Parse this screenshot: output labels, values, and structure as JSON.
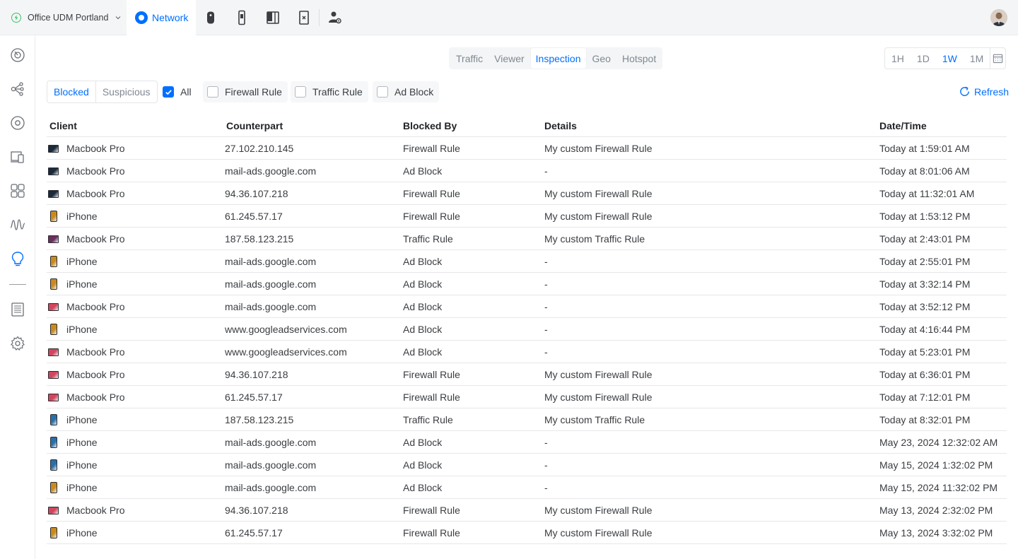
{
  "site": {
    "name": "Office UDM Portland"
  },
  "app": {
    "name": "Network",
    "accent": "#006fff"
  },
  "topbar_icons": [
    "access-point-icon",
    "phone-device-icon",
    "door-access-icon",
    "talk-device-icon",
    "admin-user-icon"
  ],
  "sidebar_icons": [
    "dashboard-icon",
    "topology-icon",
    "devices-icon",
    "client-devices-icon",
    "ports-icon",
    "insights-icon",
    "inspection-icon",
    "logs-icon",
    "settings-icon"
  ],
  "tabs": {
    "traffic": "Traffic",
    "viewer": "Viewer",
    "inspection": "Inspection",
    "geo": "Geo",
    "hotspot": "Hotspot",
    "active": "Inspection"
  },
  "range": {
    "h1": "1H",
    "d1": "1D",
    "w1": "1W",
    "m1": "1M",
    "active": "1W"
  },
  "filters": {
    "blocked": "Blocked",
    "suspicious": "Suspicious",
    "all": "All",
    "firewall": "Firewall Rule",
    "traffic": "Traffic Rule",
    "adblock": "Ad Block",
    "all_checked": true
  },
  "refresh": "Refresh",
  "columns": {
    "client": "Client",
    "counterpart": "Counterpart",
    "blocked_by": "Blocked By",
    "details": "Details",
    "datetime": "Date/Time"
  },
  "rows": [
    {
      "device": "mac",
      "color": "#1b2a3a",
      "client": "Macbook Pro",
      "counterpart": "27.102.210.145",
      "blocked_by": "Firewall Rule",
      "details": "My custom Firewall Rule",
      "datetime": "Today at 1:59:01 AM"
    },
    {
      "device": "mac",
      "color": "#1b2a3a",
      "client": "Macbook Pro",
      "counterpart": "mail-ads.google.com",
      "blocked_by": "Ad Block",
      "details": "-",
      "datetime": "Today at 8:01:06 AM"
    },
    {
      "device": "mac",
      "color": "#1b2a3a",
      "client": "Macbook Pro",
      "counterpart": "94.36.107.218",
      "blocked_by": "Firewall Rule",
      "details": "My custom Firewall Rule",
      "datetime": "Today at 11:32:01 AM"
    },
    {
      "device": "phone",
      "color": "#c98a1e",
      "client": "iPhone",
      "counterpart": "61.245.57.17",
      "blocked_by": "Firewall Rule",
      "details": "My custom Firewall Rule",
      "datetime": "Today at 1:53:12 PM"
    },
    {
      "device": "mac",
      "color": "#6a2e5c",
      "client": "Macbook Pro",
      "counterpart": "187.58.123.215",
      "blocked_by": "Traffic Rule",
      "details": "My custom Traffic Rule",
      "datetime": "Today at 2:43:01 PM"
    },
    {
      "device": "phone",
      "color": "#c98a1e",
      "client": "iPhone",
      "counterpart": "mail-ads.google.com",
      "blocked_by": "Ad Block",
      "details": "-",
      "datetime": "Today at 2:55:01 PM"
    },
    {
      "device": "phone",
      "color": "#c98a1e",
      "client": "iPhone",
      "counterpart": "mail-ads.google.com",
      "blocked_by": "Ad Block",
      "details": "-",
      "datetime": "Today at 3:32:14 PM"
    },
    {
      "device": "mac",
      "color": "#d2455c",
      "client": "Macbook Pro",
      "counterpart": "mail-ads.google.com",
      "blocked_by": "Ad Block",
      "details": "-",
      "datetime": "Today at 3:52:12 PM"
    },
    {
      "device": "phone",
      "color": "#c98a1e",
      "client": "iPhone",
      "counterpart": "www.googleadservices.com",
      "blocked_by": "Ad Block",
      "details": "-",
      "datetime": "Today at 4:16:44 PM"
    },
    {
      "device": "mac",
      "color": "#d2455c",
      "client": "Macbook Pro",
      "counterpart": "www.googleadservices.com",
      "blocked_by": "Ad Block",
      "details": "-",
      "datetime": "Today at 5:23:01 PM"
    },
    {
      "device": "mac",
      "color": "#d2455c",
      "client": "Macbook Pro",
      "counterpart": "94.36.107.218",
      "blocked_by": "Firewall Rule",
      "details": "My custom Firewall Rule",
      "datetime": "Today at 6:36:01 PM"
    },
    {
      "device": "mac",
      "color": "#d2455c",
      "client": "Macbook Pro",
      "counterpart": "61.245.57.17",
      "blocked_by": "Firewall Rule",
      "details": "My custom Firewall Rule",
      "datetime": "Today at 7:12:01 PM"
    },
    {
      "device": "phone",
      "color": "#2b6fa8",
      "client": "iPhone",
      "counterpart": "187.58.123.215",
      "blocked_by": "Traffic Rule",
      "details": "My custom Traffic Rule",
      "datetime": "Today at 8:32:01 PM"
    },
    {
      "device": "phone",
      "color": "#2b6fa8",
      "client": "iPhone",
      "counterpart": "mail-ads.google.com",
      "blocked_by": "Ad Block",
      "details": "-",
      "datetime": "May 23, 2024 12:32:02 AM"
    },
    {
      "device": "phone",
      "color": "#2b6fa8",
      "client": "iPhone",
      "counterpart": "mail-ads.google.com",
      "blocked_by": "Ad Block",
      "details": "-",
      "datetime": "May 15, 2024 1:32:02 PM"
    },
    {
      "device": "phone",
      "color": "#c98a1e",
      "client": "iPhone",
      "counterpart": "mail-ads.google.com",
      "blocked_by": "Ad Block",
      "details": "-",
      "datetime": "May 15, 2024 11:32:02 PM"
    },
    {
      "device": "mac",
      "color": "#d2455c",
      "client": "Macbook Pro",
      "counterpart": "94.36.107.218",
      "blocked_by": "Firewall Rule",
      "details": "My custom Firewall Rule",
      "datetime": "May 13, 2024 2:32:02 PM"
    },
    {
      "device": "phone",
      "color": "#c98a1e",
      "client": "iPhone",
      "counterpart": "61.245.57.17",
      "blocked_by": "Firewall Rule",
      "details": "My custom Firewall Rule",
      "datetime": "May 13, 2024 3:32:02 PM"
    }
  ]
}
